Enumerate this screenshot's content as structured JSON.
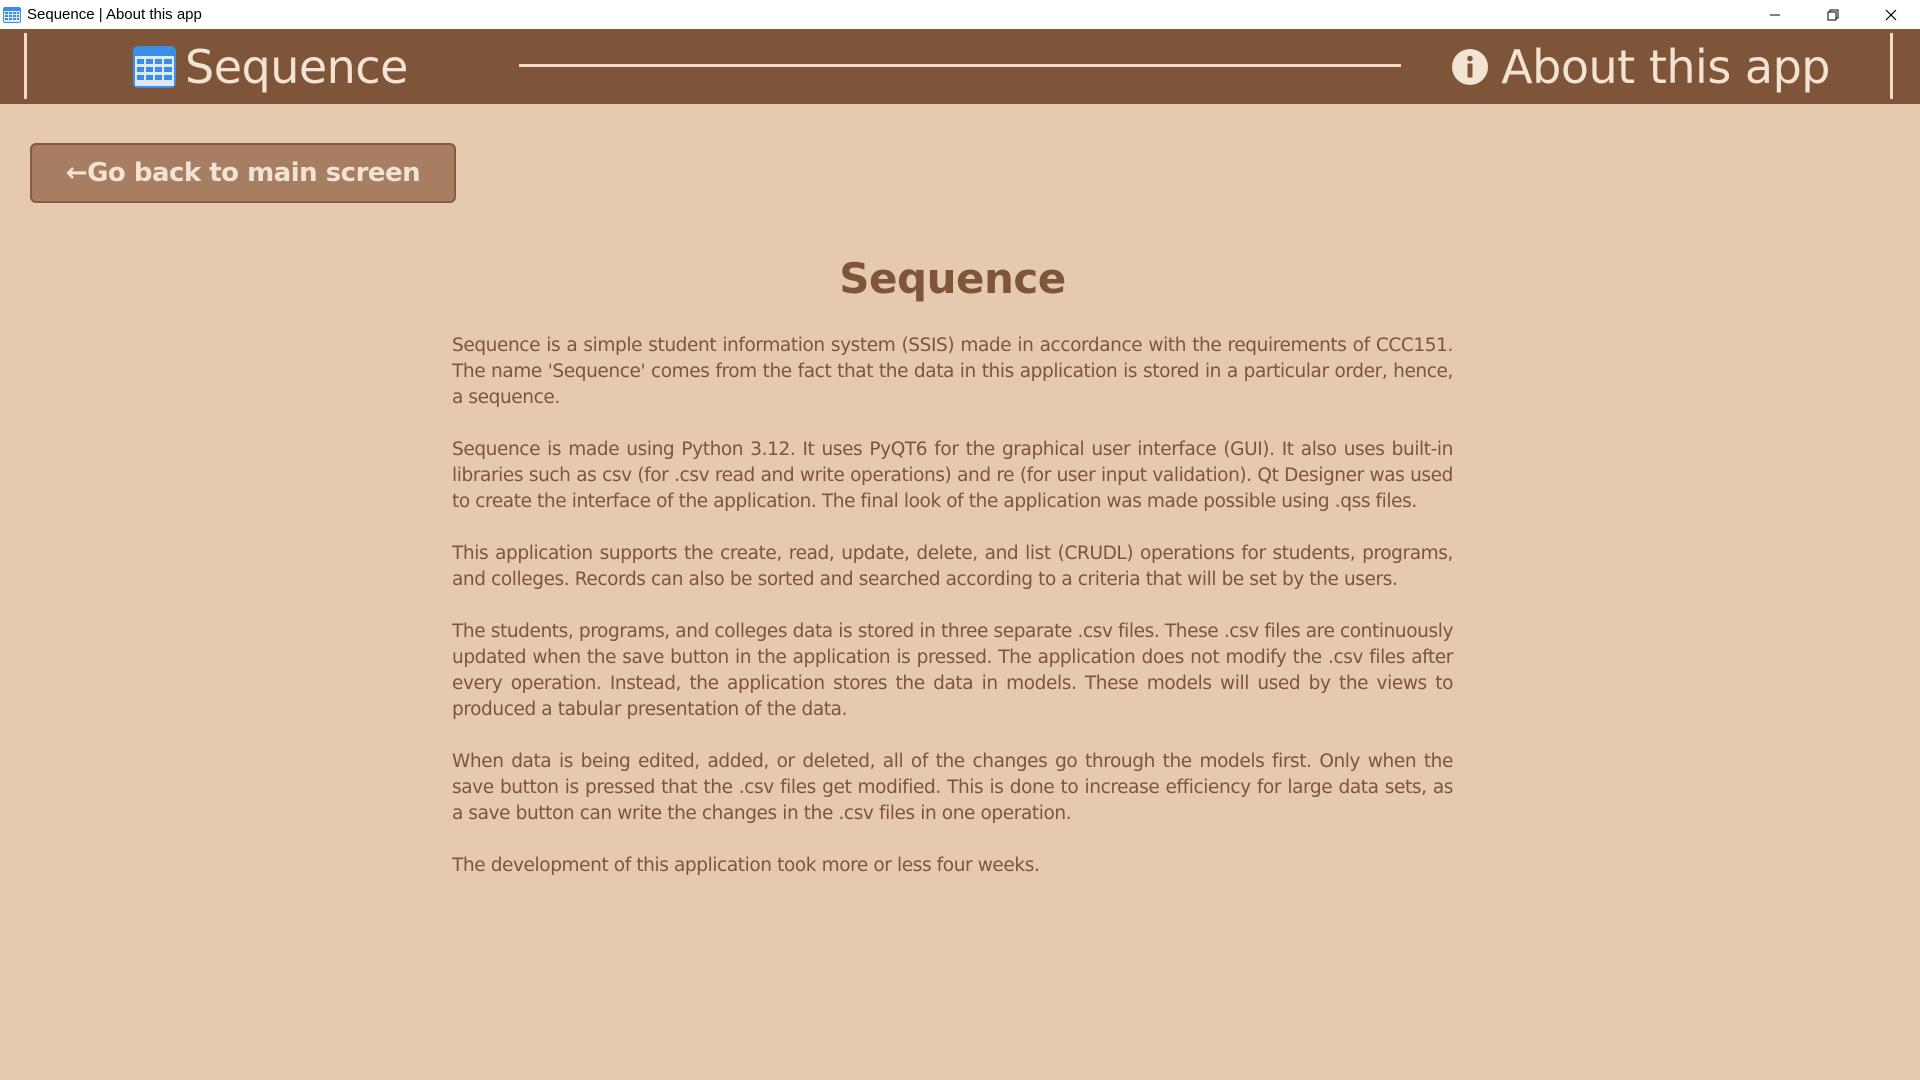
{
  "window": {
    "title": "Sequence | About this app",
    "controls": [
      "minimize",
      "restore",
      "close"
    ]
  },
  "header": {
    "brand_label": "Sequence",
    "brand_icon": "calendar-grid-icon",
    "page_label": "About this app",
    "page_icon": "info-icon"
  },
  "back_button": {
    "label": "←Go back to main screen"
  },
  "content": {
    "title": "Sequence",
    "paragraphs": [
      "Sequence is a simple student information system (SSIS) made in accordance with the requirements of CCC151. The name 'Sequence' comes from the fact that the data in this application is stored in a particular order, hence, a sequence.",
      "Sequence is made using Python 3.12. It uses PyQT6 for the graphical user interface (GUI). It also uses built-in libraries such as csv (for .csv read and write operations) and re (for user input validation). Qt Designer was used to create the interface of the application. The final look of the application was made possible using .qss files.",
      "This application supports the create, read, update, delete, and list (CRUDL) operations for students, programs, and colleges. Records can also be sorted and searched according to a criteria that will be set by the users.",
      "The students, programs, and colleges data is stored in three separate .csv files. These .csv files are continuously updated when the save button in the application is pressed. The application does not modify the .csv files after every operation. Instead, the application stores the data in models. These models will used by the views to produced a tabular presentation of the data.",
      "When data is being edited, added, or deleted, all of the changes go through the models first. Only when the save button is pressed that the .csv files get modified. This is done to increase efficiency for large data sets, as a save button can write the changes in the .csv files in one operation.",
      "The development of this application took more or less four weeks."
    ]
  },
  "colors": {
    "background": "#e5cab0",
    "header": "#7f5539",
    "header_text": "#f3e3d2",
    "button": "#a87e62",
    "body_text": "#7f5539"
  }
}
